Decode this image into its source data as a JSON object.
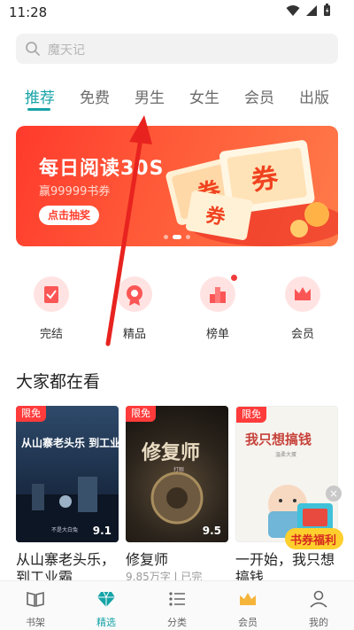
{
  "status_bar": {
    "time": "11:28",
    "icons": [
      "wifi-icon",
      "signal-icon",
      "battery-icon"
    ]
  },
  "search": {
    "placeholder": "魔天记",
    "icon": "search-icon"
  },
  "tabs": [
    {
      "label": "推荐",
      "active": true
    },
    {
      "label": "免费"
    },
    {
      "label": "男生"
    },
    {
      "label": "女生"
    },
    {
      "label": "会员"
    },
    {
      "label": "出版"
    }
  ],
  "banner": {
    "title": "每日阅读30S",
    "subtitle": "赢99999书券",
    "cta": "点击抽奖",
    "ticket_text": [
      "券",
      "券",
      "券"
    ],
    "dots": 3,
    "active_dot": 1
  },
  "quick_links": [
    {
      "label": "完结",
      "icon": "finished-icon"
    },
    {
      "label": "精品",
      "icon": "quality-icon"
    },
    {
      "label": "榜单",
      "icon": "ranking-icon",
      "has_dot": true
    },
    {
      "label": "会员",
      "icon": "crown-icon"
    }
  ],
  "section": {
    "title": "大家都在看"
  },
  "books": [
    {
      "badge": "限免",
      "cover_title": "从山寨老头乐 到工业霸主",
      "cover_author": "不是大白兔",
      "score": "9.1",
      "title": "从山寨老头乐，到工业霸",
      "sub": ""
    },
    {
      "badge": "限免",
      "cover_title": "修复师",
      "cover_author": "打眼",
      "score": "9.5",
      "title": "修复师",
      "sub": "9.85万字 | 已完"
    },
    {
      "badge": "限免",
      "cover_title": "我只想搞钱",
      "cover_author": "温柔大蛋",
      "score": "",
      "title": "一开始，我只想搞钱",
      "sub": ""
    }
  ],
  "floating": {
    "close": "×",
    "gift_text": "书券福利"
  },
  "bottom_nav": [
    {
      "label": "书架",
      "icon": "bookshelf-icon"
    },
    {
      "label": "精选",
      "icon": "diamond-icon",
      "active": true
    },
    {
      "label": "分类",
      "icon": "category-icon"
    },
    {
      "label": "会员",
      "icon": "crown-icon"
    },
    {
      "label": "我的",
      "icon": "profile-icon"
    }
  ],
  "colors": {
    "accent": "#16a3a7",
    "banner": "#ff4a30",
    "badge": "#ff3b3b",
    "annotation_arrow": "#e8231f"
  }
}
